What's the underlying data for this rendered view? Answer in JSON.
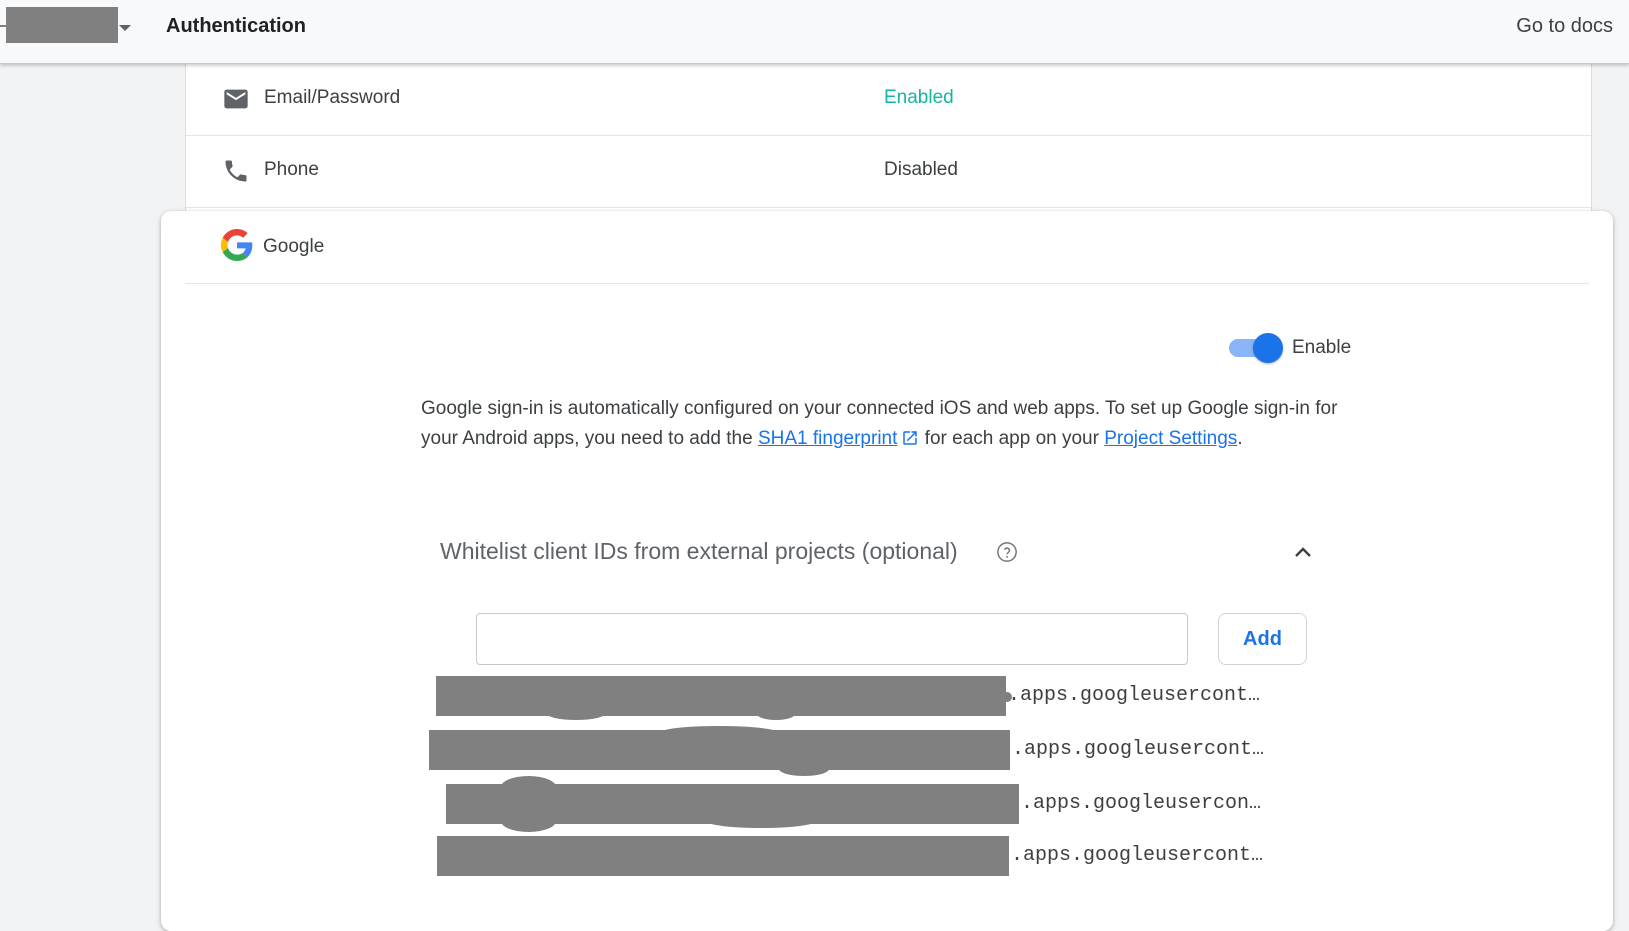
{
  "header": {
    "title": "Authentication",
    "docs_link": "Go to docs"
  },
  "providers": [
    {
      "label": "Email/Password",
      "status": "Enabled",
      "icon": "mail-icon",
      "status_color": "#12b5a2"
    },
    {
      "label": "Phone",
      "status": "Disabled",
      "icon": "phone-icon",
      "status_color": "#3c4043"
    }
  ],
  "google_provider": {
    "label": "Google",
    "icon": "google-logo-icon",
    "enable_label": "Enable",
    "enabled": true,
    "description": {
      "part1": "Google sign-in is automatically configured on your connected iOS and web apps. To set up Google sign-in for your Android apps, you need to add the ",
      "link1": "SHA1 fingerprint",
      "part2": " for each app on your ",
      "link2": "Project Settings",
      "part3": "."
    },
    "whitelist": {
      "title": "Whitelist client IDs from external projects (optional)",
      "input_value": "",
      "add_label": "Add",
      "client_ids": [
        ".apps.googleusercont…",
        ".apps.googleusercont…",
        ".apps.googleusercon…",
        ".apps.googleusercont…"
      ]
    }
  },
  "colors": {
    "accent": "#1a73e8",
    "enabled_status": "#12b5a2",
    "redaction": "#808080"
  }
}
